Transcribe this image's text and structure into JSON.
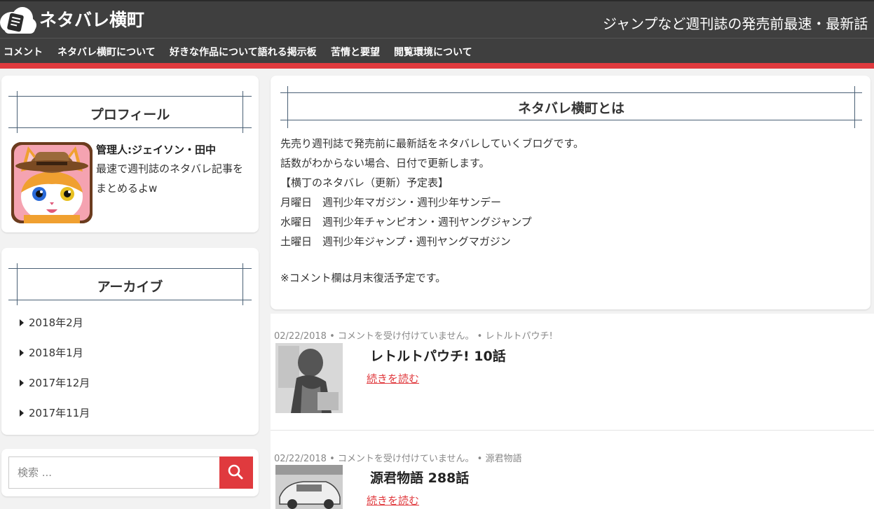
{
  "header": {
    "site_title": "ネタバレ横町",
    "tagline": "ジャンプなど週刊誌の発売前最速・最新話",
    "brand_red": "#e03a3e",
    "header_bg": "#3f3f3f"
  },
  "nav": {
    "items": [
      {
        "label": "コメント"
      },
      {
        "label": "ネタバレ横町について"
      },
      {
        "label": "好きな作品について語れる掲示板"
      },
      {
        "label": "苦情と要望"
      },
      {
        "label": "閲覧環境について"
      }
    ]
  },
  "sidebar": {
    "profile": {
      "title": "プロフィール",
      "admin_name": "管理人:ジェイソン・田中",
      "description": "最速で週刊誌のネタバレ記事をまとめるよw",
      "avatar_icon": "cat-cowboy-avatar"
    },
    "archive": {
      "title": "アーカイブ",
      "items": [
        {
          "label": "2018年2月"
        },
        {
          "label": "2018年1月"
        },
        {
          "label": "2017年12月"
        },
        {
          "label": "2017年11月"
        }
      ]
    },
    "search": {
      "placeholder": "検索 ...",
      "icon": "search-icon"
    }
  },
  "intro": {
    "title": "ネタバレ横町とは",
    "lines": [
      "先売り週刊誌で発売前に最新話をネタバレしていくブログです。",
      "話数がわからない場合、日付で更新します。",
      "【横丁のネタバレ（更新）予定表】",
      "月曜日　週刊少年マガジン・週刊少年サンデー",
      "水曜日　週刊少年チャンピオン・週刊ヤングジャンプ",
      "土曜日　週刊少年ジャンプ・週刊ヤングマガジン",
      "※コメント欄は月末復活予定です。"
    ]
  },
  "posts": [
    {
      "date": "02/22/2018",
      "comments": "コメントを受け付けていません。",
      "category": "レトルトパウチ!",
      "title": "レトルトパウチ! 10話",
      "read_more": "続きを読む"
    },
    {
      "date": "02/22/2018",
      "comments": "コメントを受け付けていません。",
      "category": "源君物語",
      "title": "源君物語 288話",
      "read_more": "続きを読む"
    }
  ]
}
